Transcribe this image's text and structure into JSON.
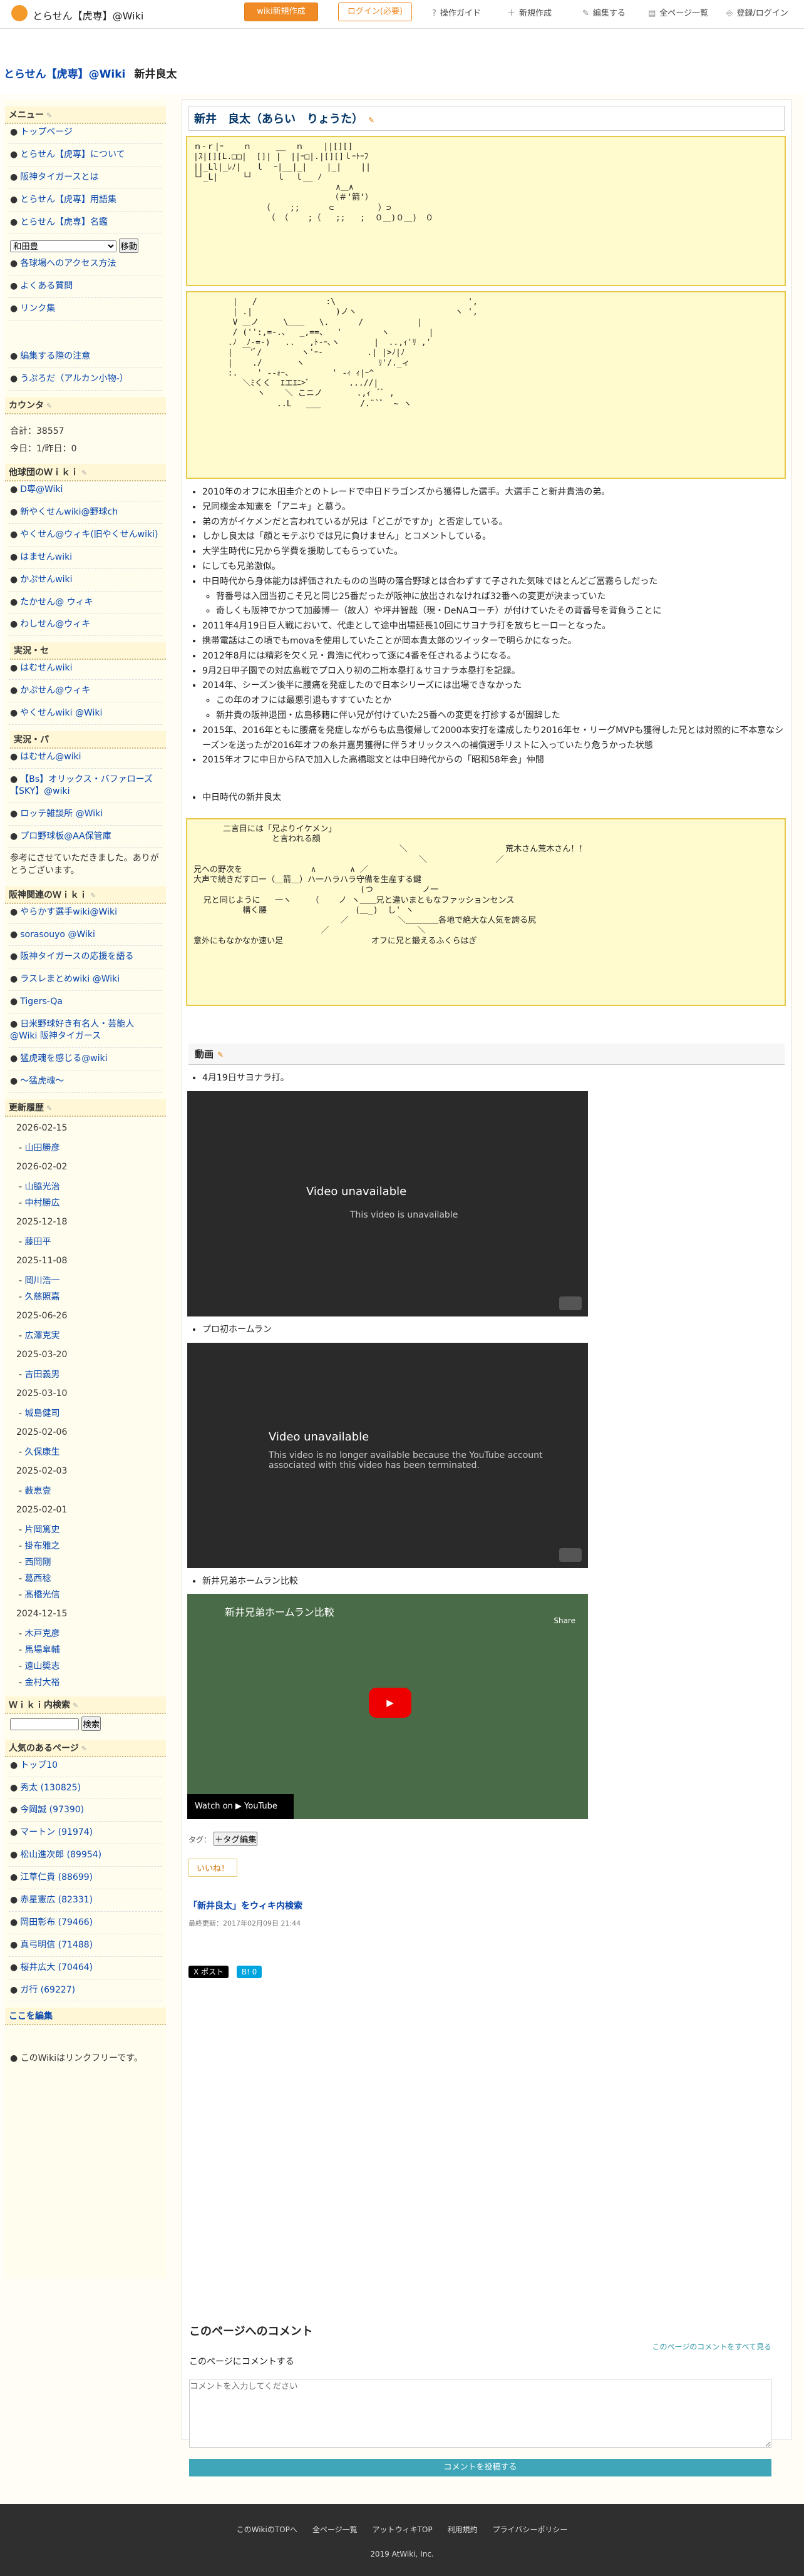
{
  "topbar": {
    "wiki_title": "とらせん【虎専】@Wiki",
    "btn_orange": "wiki新規作成",
    "btn_outline": "ログイン(必要)",
    "nav": [
      {
        "icon": "?",
        "label": "操作ガイド"
      },
      {
        "icon": "＋",
        "label": "新規作成"
      },
      {
        "icon": "✎",
        "label": "編集する"
      },
      {
        "icon": "▤",
        "label": "全ページ一覧"
      },
      {
        "icon": "⎆",
        "label": "登録/ログイン"
      }
    ]
  },
  "breadcrumb": {
    "site": "とらせん【虎専】@Wiki",
    "page": "新井良太"
  },
  "sidebar": {
    "menu_head": "メニュー",
    "menu": [
      "トップページ",
      "とらせん【虎専】について",
      "阪神タイガースとは",
      "とらせん【虎専】用語集",
      "とらせん【虎専】名鑑"
    ],
    "select_value": "和田豊",
    "move_btn": "移動",
    "menu2": [
      "各球場へのアクセス方法",
      "よくある質問",
      "リンク集"
    ],
    "menu3": [
      "編集する際の注意",
      "うぷろだ（アルカン小物-）"
    ],
    "counter_head": "カウンタ",
    "total": "合計：38557",
    "today": "今日：1/昨日：0",
    "other_head": "他球団のＷｉｋｉ",
    "other": [
      "D専@Wiki",
      "新やくせんwiki@野球ch",
      "やくせん@ウィキ(旧やくせんwiki)",
      "はませんwiki",
      "かぷせんwiki",
      "たかせん@ ウィキ",
      "わしせん@ウィキ"
    ],
    "real_head": "実況・セ",
    "real": [
      "はむせんwiki",
      "かぷせん@ウィキ",
      "やくせんwiki @Wiki"
    ],
    "pa_head": "実況・パ",
    "pa": [
      "はむせん@wiki",
      "【Bs】オリックス・バファローズ【SKY】@wiki",
      "ロッテ雑談所 @Wiki",
      "プロ野球板@AA保管庫"
    ],
    "thanks": "参考にさせていただきました。ありがとうございます。",
    "hanshin_head": "阪神関連のＷｉｋｉ",
    "hanshin": [
      "やらかす選手wiki@Wiki",
      "sorasouyo @Wiki",
      "阪神タイガースの応援を語る",
      "ラスレまとめwiki @Wiki",
      "Tigers-Qa",
      "日米野球好き有名人・芸能人@Wiki 阪神タイガース",
      "猛虎魂を感じる@wiki",
      "〜猛虎魂〜"
    ],
    "update_head": "更新履歴",
    "updates": [
      {
        "date": "2026-02-15",
        "items": [
          "山田勝彦"
        ]
      },
      {
        "date": "2026-02-02",
        "items": [
          "山脇光治",
          "中村勝広"
        ]
      },
      {
        "date": "2025-12-18",
        "items": [
          "藤田平"
        ]
      },
      {
        "date": "2025-11-08",
        "items": [
          "岡川浩一",
          "久慈照嘉"
        ]
      },
      {
        "date": "2025-06-26",
        "items": [
          "広澤克実"
        ]
      },
      {
        "date": "2025-03-20",
        "items": [
          "吉田義男"
        ]
      },
      {
        "date": "2025-03-10",
        "items": [
          "城島健司"
        ]
      },
      {
        "date": "2025-02-06",
        "items": [
          "久保康生"
        ]
      },
      {
        "date": "2025-02-03",
        "items": [
          "薮恵壹"
        ]
      },
      {
        "date": "2025-02-01",
        "items": [
          "片岡篤史",
          "掛布雅之",
          "西岡剛",
          "葛西稔",
          "髙橋光信"
        ]
      },
      {
        "date": "2024-12-15",
        "items": [
          "木戸克彦",
          "馬場皐輔",
          "遠山奬志",
          "金村大裕"
        ]
      }
    ],
    "search_head": "Ｗｉｋｉ内検索",
    "search_btn": "検索",
    "popular_head": "人気のあるページ",
    "popular": [
      "トップ10",
      "秀太 (130825)",
      "今岡誠 (97390)",
      "マートン (91974)",
      "松山進次郎 (89954)",
      "江草仁貴 (88699)",
      "赤星憲広 (82331)",
      "岡田彰布 (79466)",
      "真弓明信 (71488)",
      "桜井広大 (70464)",
      "ガ行 (69227)"
    ],
    "edit_here": "ここを編集",
    "link_free": "このWikiはリンクフリーです。"
  },
  "main": {
    "title": "新井　良太（あらい　りょうた）",
    "aa1": "ｎ-ｒ|ｰ    ｎ     __  ｎ    ||[][]\n|ｽ|[][L.□□|  []| |  ||ｰ□|.|[][]ｌｰﾄｰﾌ\n||_Ll|_ﾚﾉ|   ｌ  ｰ|__|_|    |_|    ||\n└┘_L|     └┘     ｌ  ｌ__ ﾉ\n                             ∧＿∧\n                            （＃‘箭‘）\n              （    ;;      ⊂         ）⊃\n               （ （    ;（   ;;   ;  ０＿)０＿)　０",
    "aa2": "        |   /              :\\                           ',\n        | .|                 )ノヽ                    ヽ ',\n        V ＿ノ     \\＿＿   \\.      /           |\n        / ('':,=-.、  _,==、  '        ヽ        |\n       .ﾉ  ﾉ-=-)   ..   ,ﾄ-ｰ､ヽ       |  ..,ｨ'ﾘ ,'\n       |  ￣'ﾞ/        ヽ'ｰ-         .| |>ﾉ|ﾉ\n       |    ./       ヽ               ﾘ'/._ィ\n       :.    ' --ｫｰ、        ' -ｨ ｨ|ｰ^\n          ＼ﾐくく  ｴエｴﾆ>ﾞ        ...//|\n             ヽ    ＼ こニノ       .,ｨ ´ﾞ ,\n                 ..L   ___        /.¨`ﾞ  ~ ヽ",
    "bullets": [
      "2010年のオフに水田圭介とのトレードで中日ドラゴンズから獲得した選手。大選手こと新井貴浩の弟。",
      "兄同様金本知憲を「アニキ」と慕う。",
      "弟の方がイケメンだと言われているが兄は「どこがですか」と否定している。",
      "しかし良太は「顔とモテぶりでは兄に負けません」とコメントしている。",
      "大学生時代に兄から学費を援助してもらっていた。",
      "にしても兄弟激似。",
      "中日時代から身体能力は評価されたものの当時の落合野球とは合わずすて子された気味ではとんどご冨霧らしだった"
    ],
    "sub1": [
      "背番号は入団当初こそ兄と同じ25番だったが阪神に放出されなければ32番への変更が決まっていた",
      "奇しくも阪神でかつて加藤博一（故人）や坪井智哉（現・DeNAコーチ）が付けていたその背番号を背負うことに"
    ],
    "bullets2": [
      "2011年4月19日巨人戦において、代走として途中出場延長10回にサヨナラ打を放ちヒーローとなった。",
      "携帯電話はこの頃でもmovaを使用していたことが岡本貴太郎のツイッターで明らかになった。",
      "2012年8月には精彩を欠く兄・貴浩に代わって逐に4番を任されるようになる。",
      "9月2日甲子園での対広島戦でプロ入り初の二桁本塁打＆サヨナラ本塁打を記録。",
      "2014年、シーズン後半に腰痛を発症したので日本シリーズには出場できなかった"
    ],
    "sub2": [
      "この年のオフには最悪引退もすすていたとか",
      "新井貴の阪神退団・広島移籍に伴い兄が付けていた25番への変更を打診するが固辞した"
    ],
    "bullets3": [
      "2015年、2016年ともに腰痛を発症しながらも広島復帰して2000本安打を達成したり2016年セ・リーグMVPも獲得した兄とは対照的に不本意なシーズンを送ったが2016年オフの糸井嘉男獲得に伴うオリックスへの補償選手リストに入っていたり危うかった状態",
      "2015年オフに中日からFAで加入した高橋聡文とは中日時代からの「昭和58年会」仲間"
    ],
    "b_chunichi": "中日時代の新井良太",
    "aa3": "      二言目には「兄よりイケメン」\n                と言われる顔\n                                          ＼                    荒木さん荒木さん！！\n                                              ＼              ／\n兄への野次を              ∧       ∧ ／\n大声で続きだすロー（＿箭＿）ハ一ハラハラ守備を生産する鍵\n                                  (つ          ノ一\n  兄と同じように   一ヽ    （    ノ ヽ＿＿兄と違いまともなファッションセンス\n          構く腰                  (＿_)  し' ヽ\n                              ／          ＼＿＿＿＿各地で絶大な人気を誇る尻\n                          ／                  ＼\n意外にもなかなか速い足                  オフに兄と鍛えるふくらはぎ",
    "video_head": "動画",
    "v1_label": "4月19日サヨナラ打。",
    "v1_title": "Video unavailable",
    "v1_sub": "This video is unavailable",
    "v2_label": "プロ初ホームラン",
    "v2_title": "Video unavailable",
    "v2_sub": "This video is no longer available because the YouTube account associated with this video has been terminated.",
    "v3_label": "新井兄弟ホームラン比較",
    "v3_title": "新井兄弟ホームラン比較",
    "v3_share": "Share",
    "v3_watch": "Watch on ▶ YouTube",
    "tag_label": "タグ：",
    "tag_btn": "＋タグ編集",
    "like": "いいね！",
    "search_wiki": "「新井良太」をウィキ内検索",
    "updated": "最終更新：2017年02月09日 21:44",
    "post_btn": "X ポスト",
    "share_btn": "B! 0",
    "comment_title": "このページへのコメント",
    "comment_all": "このページのコメントをすべて見る",
    "comment_sub": "このページにコメントする",
    "comment_placeholder": "コメントを入力してください",
    "comment_submit": "コメントを投稿する"
  },
  "footer": {
    "links": [
      "このWikiのTOPへ",
      "全ページ一覧",
      "アットウィキTOP",
      "利用規約",
      "プライバシーポリシー"
    ],
    "copyright": "2019 AtWiki, Inc."
  }
}
